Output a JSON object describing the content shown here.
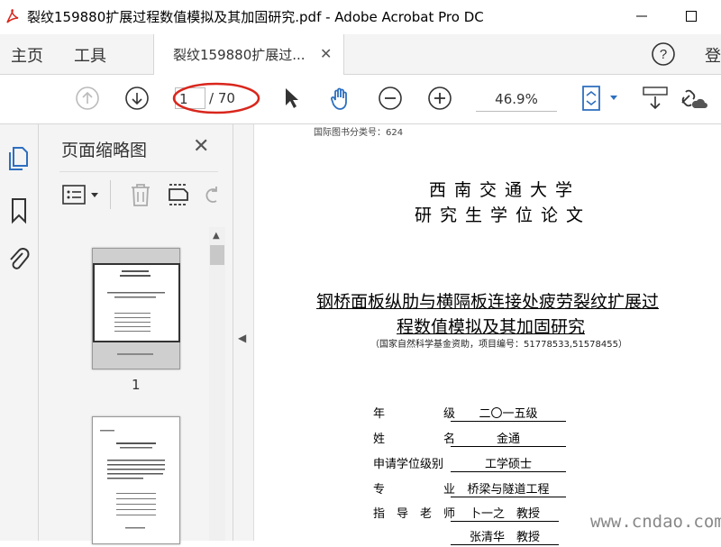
{
  "window": {
    "title": "裂纹159880扩展过程数值模拟及其加固研究.pdf - Adobe Acrobat Pro DC"
  },
  "menu": {
    "home": "主页",
    "tools": "工具",
    "doc_tab": "裂纹159880扩展过...",
    "sign_in_partial": "登"
  },
  "toolbar": {
    "current_page": "1",
    "total_pages": "/ 70",
    "zoom": "46.9%"
  },
  "thumbnails": {
    "title": "页面缩略图",
    "page1_label": "1"
  },
  "document": {
    "class_number": "国际图书分类号：624",
    "university": "西南交通大学",
    "thesis_type": "研究生学位论文",
    "title_line1": "钢桥面板纵肋与横隔板连接处疲劳裂纹扩展过",
    "title_line2": "程数值模拟及其加固研究",
    "funding": "（国家自然科学基金资助，项目编号：51778533,51578455）",
    "fields": [
      {
        "label": "年　　　　　级",
        "value": "二〇一五级"
      },
      {
        "label": "姓　　　　　名",
        "value": "金通"
      },
      {
        "label": "申请学位级别",
        "value": "工学硕士"
      },
      {
        "label": "专　　　　　业",
        "value": "桥梁与隧道工程"
      },
      {
        "label": "指　导　老　师",
        "value": "卜一之　教授"
      },
      {
        "label": "",
        "value": "张清华　教授"
      }
    ]
  },
  "watermark": "www.cndao.com",
  "colors": {
    "accent_blue": "#2d6fbf",
    "annotation_red": "#d9261c"
  }
}
